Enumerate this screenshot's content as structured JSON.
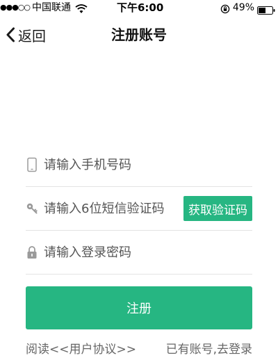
{
  "status_bar": {
    "signal": "●●●○○",
    "carrier": "中国联通",
    "time": "下午6:00",
    "battery_percent": "49%"
  },
  "nav": {
    "back_label": "返回",
    "title": "注册账号"
  },
  "form": {
    "phone": {
      "placeholder": "请输入手机号码",
      "value": ""
    },
    "code": {
      "placeholder": "请输入6位短信验证码",
      "value": "",
      "button_label": "获取验证码"
    },
    "password": {
      "placeholder": "请输入登录密码",
      "value": ""
    },
    "submit_label": "注册"
  },
  "footer": {
    "agreement_link": "阅读<<用户协议>>",
    "login_link": "已有账号,去登录"
  },
  "colors": {
    "accent": "#26b682",
    "divider": "#e3e3e3",
    "icon_gray": "#9a9a9a"
  }
}
